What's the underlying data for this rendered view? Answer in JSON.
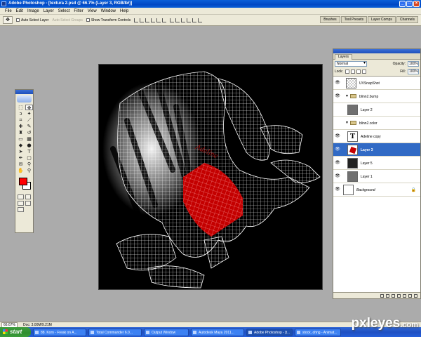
{
  "window": {
    "title": "Adobe Photoshop - [textura 2.psd @ 66.7% (Layer 3, RGB/8#)]"
  },
  "menu": [
    "File",
    "Edit",
    "Image",
    "Layer",
    "Select",
    "Filter",
    "View",
    "Window",
    "Help"
  ],
  "options_bar": {
    "auto_select": "Auto Select Layer",
    "auto_select_groups": "Auto Select Groups",
    "show_transform": "Show Transform Controls"
  },
  "palette_well": [
    "Brushes",
    "Tool Presets",
    "Layer Comps",
    "Channels"
  ],
  "layers_panel": {
    "tab": "Layers",
    "blend_mode": "Normal",
    "opacity_label": "Opacity:",
    "opacity": "100%",
    "lock_label": "Lock:",
    "fill_label": "Fill:",
    "fill": "100%",
    "layers": [
      {
        "name": "UVSnapShot",
        "thumb": "check",
        "visible": true,
        "indent": 0,
        "type": "layer"
      },
      {
        "name": "blinn2.bump",
        "thumb": "folder",
        "visible": true,
        "indent": 0,
        "type": "group"
      },
      {
        "name": "Layer 2",
        "thumb": "gray",
        "visible": false,
        "indent": 1,
        "type": "layer"
      },
      {
        "name": "blinn2.color",
        "thumb": "folder",
        "visible": false,
        "indent": 0,
        "type": "group"
      },
      {
        "name": "Adeline copy",
        "thumb": "text",
        "visible": true,
        "indent": 1,
        "type": "layer"
      },
      {
        "name": "Layer 3",
        "thumb": "red",
        "visible": true,
        "indent": 1,
        "type": "layer",
        "selected": true
      },
      {
        "name": "Layer 5",
        "thumb": "dark",
        "visible": true,
        "indent": 1,
        "type": "layer"
      },
      {
        "name": "Layer 1",
        "thumb": "gray",
        "visible": true,
        "indent": 1,
        "type": "layer"
      },
      {
        "name": "Background",
        "thumb": "white",
        "visible": true,
        "indent": 0,
        "type": "background"
      }
    ]
  },
  "status": {
    "zoom": "66.67%",
    "doc": "Doc: 3.00M/9.21M"
  },
  "taskbar": {
    "start": "start",
    "tasks": [
      "88. Korn - Freak on A...",
      "Total Commander 6.0...",
      "Output Window",
      "Autodesk Maya 2011...",
      "Adobe Photoshop - [t...",
      "stock..ohng - Animat..."
    ]
  },
  "watermark": {
    "main": "pxleyes",
    "sub": ".com"
  }
}
